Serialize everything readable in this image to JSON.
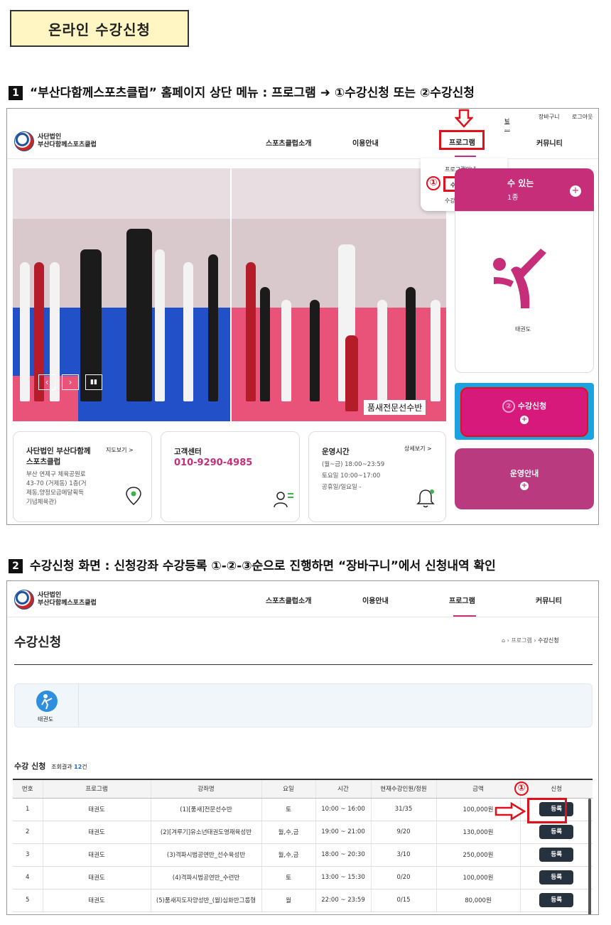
{
  "doc_title": "온라인 수강신청",
  "step1": {
    "number": "1",
    "heading": "“부산다함께스포츠클럽” 홈페이지 상단 메뉴 : 프로그램 ➜ ①수강신청 또는 ②수강신청"
  },
  "step2": {
    "number": "2",
    "heading": "수강신청 화면 : 신청강좌 수강등록 ①-②-③순으로 진행하면 “장바구니”에서 신청내역 확인"
  },
  "site": {
    "logo_line1": "사단법인",
    "logo_line2": "부산다함께스포츠클럽",
    "topbar": {
      "user": "님",
      "cart": "장바구니",
      "logout": "로그아웃"
    },
    "nav": [
      "스포츠클럽소개",
      "이용안내",
      "프로그램",
      "커뮤니티"
    ],
    "dropdown": [
      "프로그램안내",
      "수강신청",
      "수강신청안내"
    ],
    "photo_caption": "품새전문선수반",
    "side_top": {
      "title": "수 있는",
      "sub": "1종",
      "plus": "+"
    },
    "sport_label": "태권도",
    "apply_button": "수강신청",
    "ops_button": "운영안내",
    "plus": "+",
    "info_cards": [
      {
        "title": "사단법인 부산다함께\n스포츠클럽",
        "link": "지도보기 >",
        "body": "부산 연제구 체육공원로\n43-70 (거제동) 1층(거\n제동,양정모금메달획득\n기념체육관)"
      },
      {
        "title": "고객센터",
        "link": "",
        "body": "010-9290-4985"
      },
      {
        "title": "운영시간",
        "link": "상세보기 >",
        "body": "(월~금)  18:00~23:59\n토요일  10:00~17:00\n공휴일/일요일  -"
      }
    ],
    "markers": {
      "one": "①",
      "two": "②"
    }
  },
  "app": {
    "page_title": "수강신청",
    "breadcrumb": [
      "프로그램",
      "수강신청"
    ],
    "category": "태권도",
    "section_title": "수강 신청",
    "result_prefix": "조회결과",
    "result_count": "12",
    "result_suffix": "건",
    "columns": [
      "번호",
      "프로그램",
      "강좌명",
      "요일",
      "시간",
      "현재수강인원/정원",
      "금액",
      "신청"
    ],
    "rows": [
      [
        "1",
        "태권도",
        "(1)[품새]전문선수반",
        "토",
        "10:00 ~ 16:00",
        "31/35",
        "100,000원",
        "등록"
      ],
      [
        "2",
        "태권도",
        "(2)[겨루기]유소년태권도영재육성반",
        "월,수,금",
        "19:00 ~ 21:00",
        "9/20",
        "130,000원",
        "등록"
      ],
      [
        "3",
        "태권도",
        "(3)격파시범공연반_선수육성반",
        "월,수,금",
        "18:00 ~ 20:30",
        "3/10",
        "250,000원",
        "등록"
      ],
      [
        "4",
        "태권도",
        "(4)격파시범공연반_수련반",
        "토",
        "13:00 ~ 15:30",
        "0/20",
        "100,000원",
        "등록"
      ],
      [
        "5",
        "태권도",
        "(5)품새지도자양성반_(월)심화반그룹형",
        "월",
        "22:00 ~ 23:59",
        "0/15",
        "80,000원",
        "등록"
      ]
    ],
    "marker_one": "①"
  },
  "colors": {
    "accent": "#c62e7a",
    "highlight": "#e0111b",
    "dark_button": "#27323f"
  }
}
